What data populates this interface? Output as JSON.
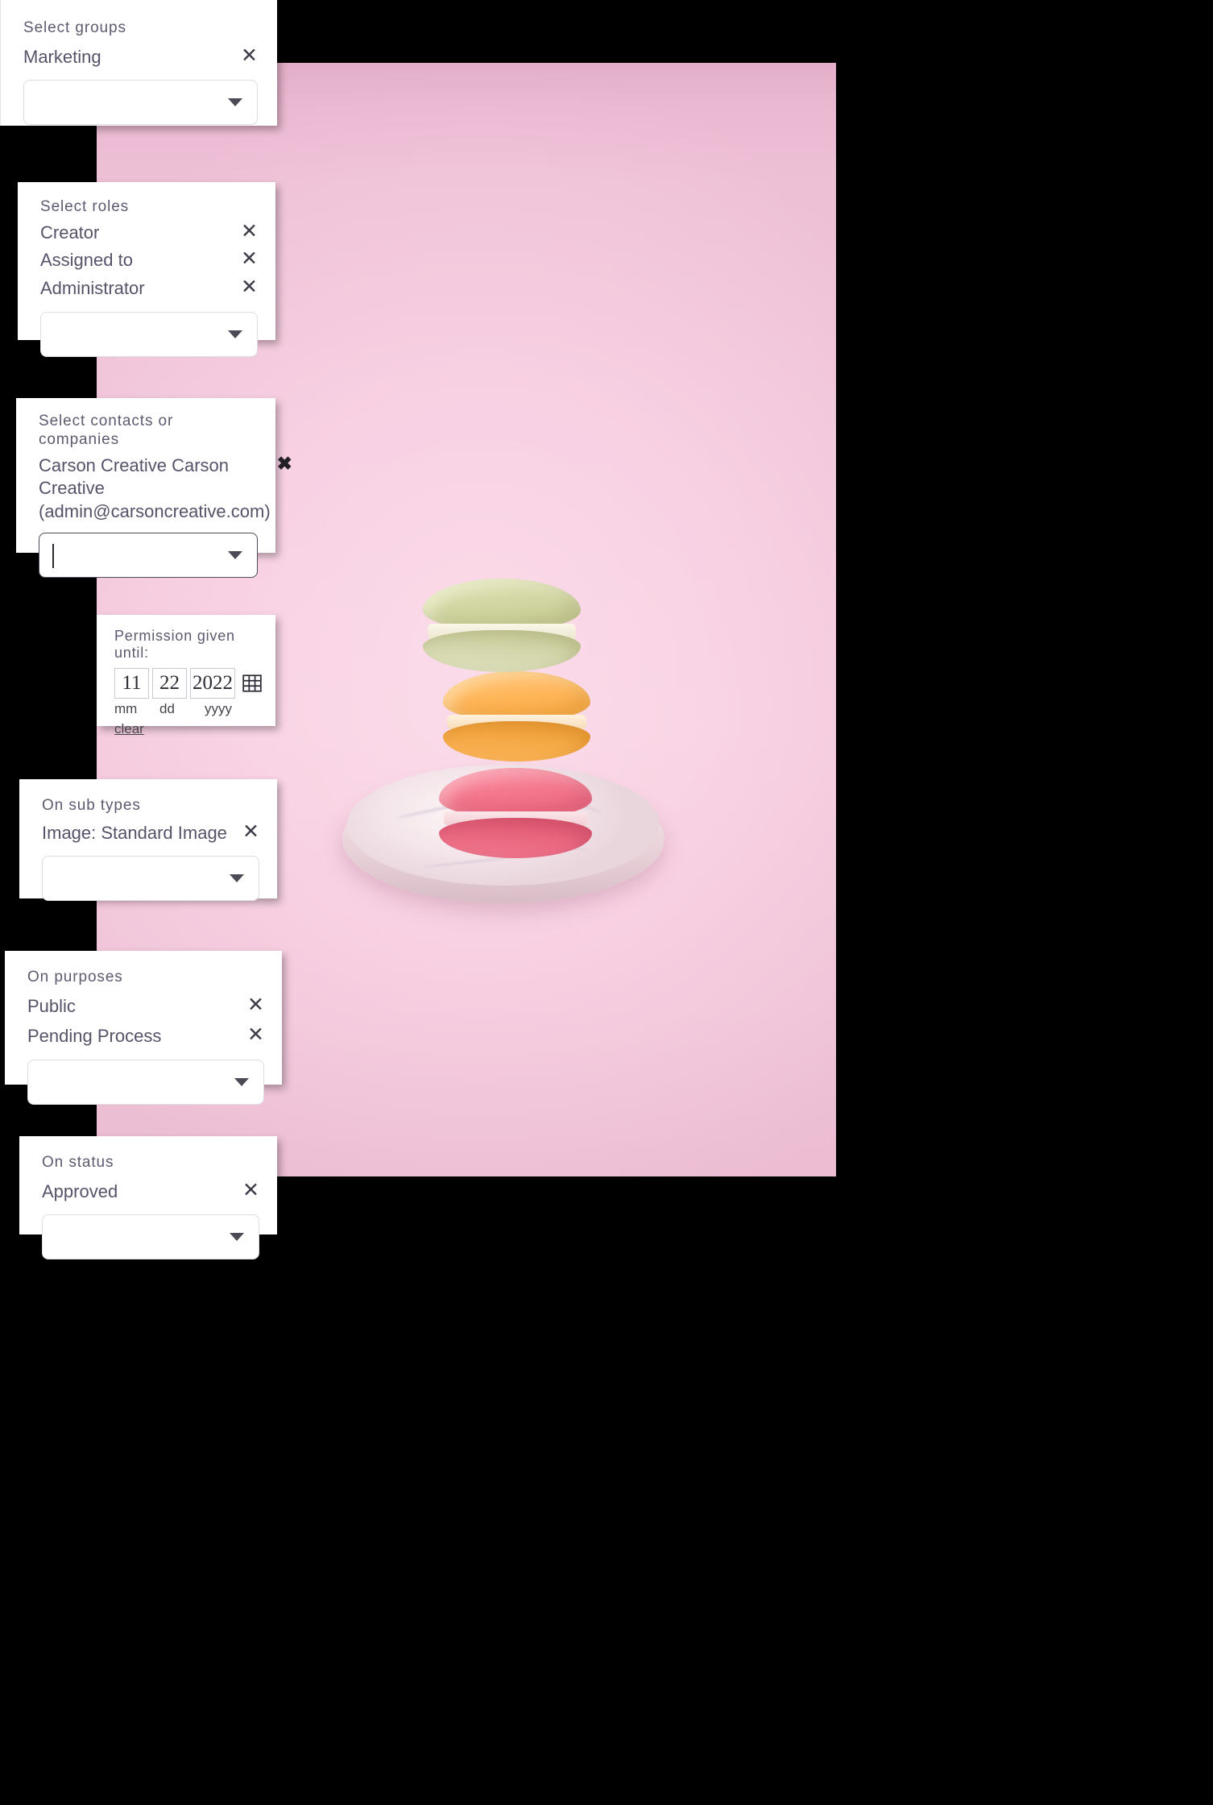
{
  "background": {
    "page_color": "#000000",
    "photo": {
      "name": "macaron-product-photo",
      "backdrop_color": "#f8cfe2",
      "subjects": [
        "pistachio macaron",
        "orange macaron",
        "pink macaron",
        "marble coaster"
      ]
    }
  },
  "panels": {
    "groups": {
      "label": "Select groups",
      "chips": [
        {
          "text": "Marketing",
          "remove_icon": "✕"
        }
      ],
      "select": {
        "placeholder": "",
        "value": "",
        "caret_icon": "▼"
      }
    },
    "roles": {
      "label": "Select roles",
      "chips": [
        {
          "text": "Creator",
          "remove_icon": "✕"
        },
        {
          "text": "Assigned to",
          "remove_icon": "✕"
        },
        {
          "text": "Administrator",
          "remove_icon": "✕"
        }
      ],
      "select": {
        "placeholder": "",
        "value": "",
        "caret_icon": "▼"
      }
    },
    "contacts": {
      "label": "Select contacts or companies",
      "chips": [
        {
          "text": "Carson Creative  Carson Creative (admin@carsoncreative.com)",
          "remove_icon": "✖"
        }
      ],
      "select": {
        "placeholder": "",
        "value": "",
        "caret_icon": "▼",
        "focused": true
      }
    },
    "date": {
      "label": "Permission given until:",
      "month": "11",
      "day": "22",
      "year": "2022",
      "month_hint": "mm",
      "day_hint": "dd",
      "year_hint": "yyyy",
      "calendar_icon": "calendar-icon",
      "clear_label": "clear"
    },
    "subtypes": {
      "label": "On sub types",
      "chips": [
        {
          "text": "Image: Standard Image",
          "remove_icon": "✕"
        }
      ],
      "select": {
        "placeholder": "",
        "value": "",
        "caret_icon": "▼"
      }
    },
    "purposes": {
      "label": "On purposes",
      "chips": [
        {
          "text": "Public",
          "remove_icon": "✕"
        },
        {
          "text": "Pending Process",
          "remove_icon": "✕"
        }
      ],
      "select": {
        "placeholder": "",
        "value": "",
        "caret_icon": "▼"
      }
    },
    "status": {
      "label": "On status",
      "chips": [
        {
          "text": "Approved",
          "remove_icon": "✕"
        }
      ],
      "select": {
        "placeholder": "",
        "value": "",
        "caret_icon": "▼"
      }
    }
  }
}
